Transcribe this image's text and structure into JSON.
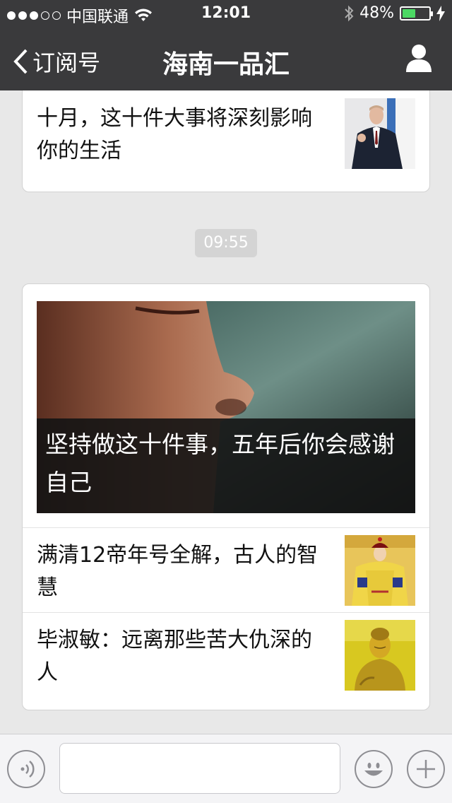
{
  "status": {
    "carrier": "中国联通",
    "signal_bars_filled": 3,
    "signal_bars_total": 5,
    "time": "12:01",
    "battery_percent": "48%",
    "battery_level": 0.48
  },
  "nav": {
    "back_label": "订阅号",
    "title": "海南一品汇"
  },
  "messages": {
    "card1": {
      "title": "十月，这十件大事将深刻影响你的生活",
      "thumb_icon": "person-photo-thumbnail"
    },
    "timestamp": "09:55",
    "card2": {
      "hero_title": "坚持做这十件事，五年后你会感谢自己",
      "hero_icon": "buddha-face-photo",
      "items": [
        {
          "title": "满清12帝年号全解，古人的智慧",
          "thumb_icon": "emperor-portrait-thumbnail"
        },
        {
          "title": "毕淑敏：远离那些苦大仇深的人",
          "thumb_icon": "golden-buddha-thumbnail"
        }
      ]
    }
  },
  "input_bar": {
    "voice_icon": "voice-icon",
    "emoji_icon": "emoji-icon",
    "plus_icon": "plus-icon",
    "text_value": ""
  },
  "colors": {
    "nav_bg": "#3a3a3c",
    "chat_bg": "#e8e8e8",
    "battery_green": "#4cd964"
  }
}
